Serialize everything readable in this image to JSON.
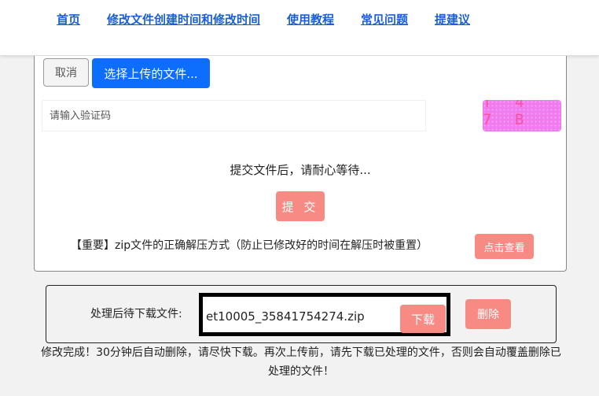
{
  "nav": {
    "items": [
      {
        "label": "首页"
      },
      {
        "label": "修改文件创建时间和修改时间"
      },
      {
        "label": "使用教程"
      },
      {
        "label": "常见问题"
      },
      {
        "label": "提建议"
      }
    ]
  },
  "upload": {
    "cancel_label": "取消",
    "choose_label": "选择上传的文件...",
    "captcha_placeholder": "请输入验证码",
    "captcha_code": "T 4 7 B",
    "wait_text": "提交文件后，请耐心等待...",
    "submit_label": "提 交",
    "important_text": "【重要】zip文件的正确解压方式（防止已修改好的时间在解压时被重置）",
    "view_label": "点击查看"
  },
  "download": {
    "label": "处理后待下载文件:",
    "filename": "et10005_35841754274.zip",
    "download_label": "下载",
    "delete_label": "删除"
  },
  "notice": {
    "text": "修改完成！30分钟后自动删除，请尽快下载。再次上传前，请先下载已处理的文件，否则会自动覆盖删除已处理的文件！"
  },
  "colors": {
    "primary": "#0d6efd",
    "danger_light": "#f88a84",
    "nav_link": "#1a5fd6"
  }
}
